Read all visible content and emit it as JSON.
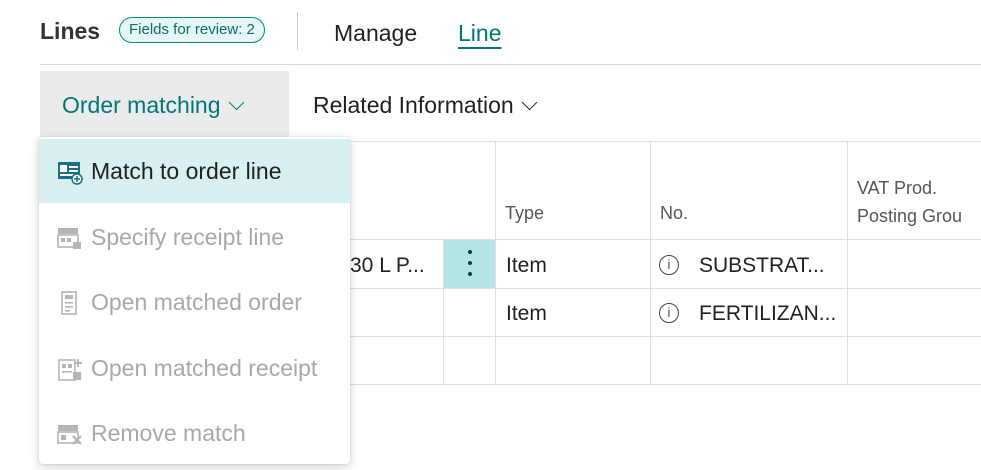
{
  "header": {
    "title": "Lines",
    "badge": "Fields for review: 2",
    "nav": {
      "manage": "Manage",
      "line": "Line"
    }
  },
  "toolbar": {
    "order_matching": "Order matching",
    "related_information": "Related Information"
  },
  "menu": {
    "items": [
      {
        "label": "Match to order line",
        "state": "active",
        "icon": "match-order-line-icon"
      },
      {
        "label": "Specify receipt line",
        "state": "disabled",
        "icon": "specify-receipt-line-icon"
      },
      {
        "label": "Open matched order",
        "state": "disabled",
        "icon": "open-matched-order-icon"
      },
      {
        "label": "Open matched receipt",
        "state": "disabled",
        "icon": "open-matched-receipt-icon"
      },
      {
        "label": "Remove match",
        "state": "disabled",
        "icon": "remove-match-icon"
      }
    ]
  },
  "grid": {
    "columns": {
      "type": "Type",
      "no": "No.",
      "vat_line1": "VAT Prod.",
      "vat_line2": "Posting Grou"
    },
    "rows": [
      {
        "desc": "30 L P...",
        "type": "Item",
        "no": "SUBSTRAT..."
      },
      {
        "desc": "",
        "type": "Item",
        "no": "FERTILIZAN..."
      }
    ]
  },
  "colors": {
    "accent": "#00757a",
    "badge_border": "#008489",
    "menu_active": "#d9f0f1",
    "selected_cell": "#b3e5e8",
    "disabled_text": "#a8a8a8"
  }
}
